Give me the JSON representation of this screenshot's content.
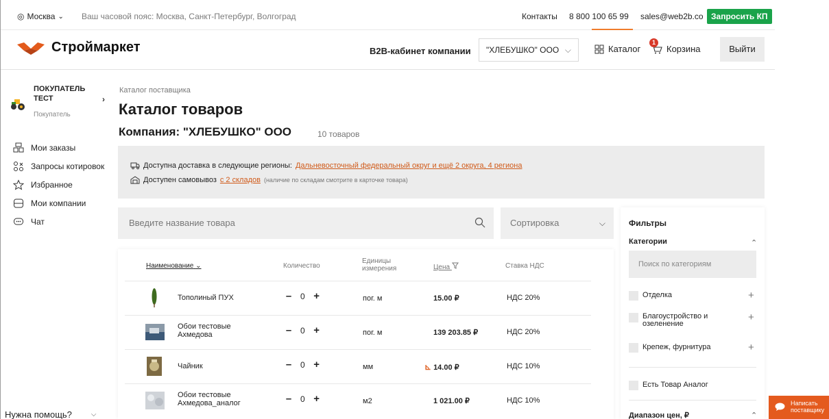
{
  "topbar": {
    "city": "Москва",
    "timezone": "Ваш часовой пояс: Москва, Санкт-Петербург, Волгоград",
    "contacts": "Контакты",
    "phone": "8 800 100 65 99",
    "email": "sales@web2b.co",
    "request_button": "Запросить КП"
  },
  "header": {
    "logo_name": "Строймаркет",
    "b2b_label": "B2B-кабинет компании",
    "company": "\"ХЛЕБУШКО\" ООО",
    "catalog": "Каталог",
    "cart": "Корзина",
    "cart_count": "1",
    "logout": "Выйти"
  },
  "sidebar": {
    "buyer_line1": "ПОКУПАТЕЛЬ",
    "buyer_line2": "ТЕСТ",
    "buyer_role": "Покупатель",
    "items": [
      {
        "label": "Мои заказы",
        "icon": "orders-icon"
      },
      {
        "label": "Запросы котировок",
        "icon": "quotes-icon"
      },
      {
        "label": "Избранное",
        "icon": "star-icon"
      },
      {
        "label": "Мои компании",
        "icon": "companies-icon"
      },
      {
        "label": "Чат",
        "icon": "chat-icon"
      }
    ],
    "help": "Нужна помощь?"
  },
  "main": {
    "breadcrumb": "Каталог поставщика",
    "title": "Каталог товаров",
    "subtitle": "Компания: \"ХЛЕБУШКО\" ООО",
    "count": "10 товаров",
    "delivery_text": "Доступна доставка в следующие регионы:",
    "delivery_link": "Дальневосточный федеральный округ и ещё 2 округа, 4 региона",
    "pickup_text": "Доступен самовывоз",
    "pickup_link": "с 2 складов",
    "pickup_note": "(наличие по складам смотрите в карточке товара)",
    "search_placeholder": "Введите название товара",
    "sort_label": "Сортировка"
  },
  "table": {
    "headers": {
      "name": "Наименование",
      "qty": "Количество",
      "unit_1": "Единицы",
      "unit_2": "измерения",
      "price": "Цена",
      "vat": "Ставка НДС"
    },
    "rows": [
      {
        "name_1": "Тополиный ПУХ",
        "name_2": "",
        "qty": "0",
        "unit": "пог. м",
        "price": "15.00 ₽",
        "vat": "НДС 20%"
      },
      {
        "name_1": "Обои тестовые",
        "name_2": "Ахмедова",
        "qty": "0",
        "unit": "пог. м",
        "price": "139 203.85 ₽",
        "vat": "НДС 20%"
      },
      {
        "name_1": "Чайник",
        "name_2": "",
        "qty": "0",
        "unit": "мм",
        "price": "14.00 ₽",
        "vat": "НДС 10%"
      },
      {
        "name_1": "Обои тестовые",
        "name_2": "Ахмедова_аналог",
        "qty": "0",
        "unit": "м2",
        "price": "1 021.00 ₽",
        "vat": "НДС 10%"
      }
    ]
  },
  "filters": {
    "title": "Фильтры",
    "categories": "Категории",
    "category_search": "Поиск по категориям",
    "items": [
      {
        "label_1": "Отделка",
        "label_2": ""
      },
      {
        "label_1": "Благоустройство и",
        "label_2": "озеленение"
      },
      {
        "label_1": "Крепеж, фурнитура",
        "label_2": ""
      }
    ],
    "analog": "Есть Товар Аналог",
    "price_range": "Диапазон цен, ₽"
  },
  "write_button": {
    "line1": "Написать",
    "line2": "поставщику"
  },
  "colors": {
    "accent": "#f07c2b",
    "green": "#1aa34a",
    "link": "#d05a19",
    "write": "#e45a1e"
  }
}
